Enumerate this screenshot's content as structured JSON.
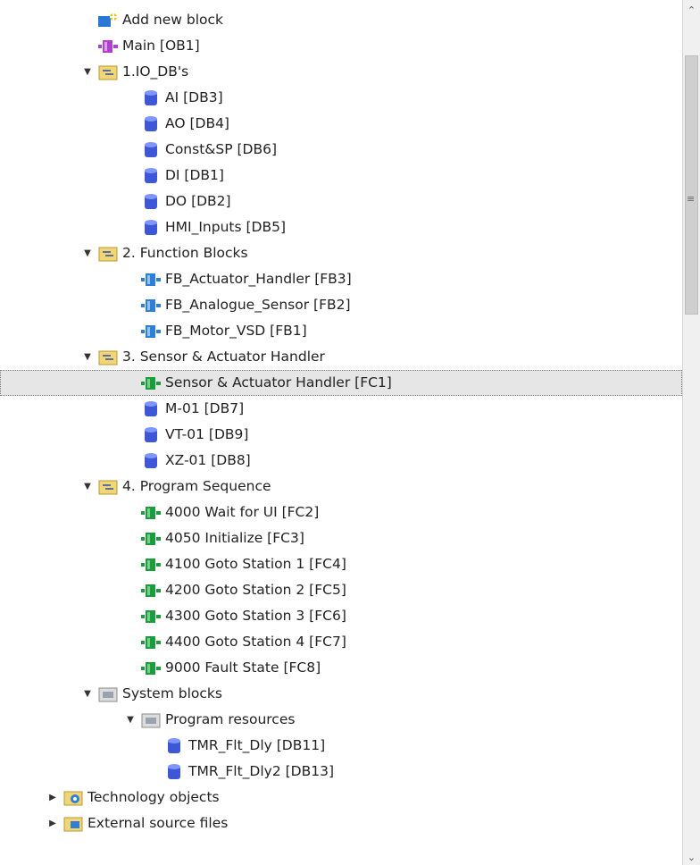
{
  "rows": [
    {
      "label": "Add new block",
      "icon": "add-block-icon",
      "level": 0,
      "toggle": "none"
    },
    {
      "label": "Main [OB1]",
      "icon": "ob-block-icon",
      "level": 0,
      "toggle": "none"
    },
    {
      "label": "1.IO_DB's",
      "icon": "folder-icon",
      "level": 0,
      "toggle": "expanded"
    },
    {
      "label": "AI [DB3]",
      "icon": "db-icon",
      "level": 1,
      "toggle": "none"
    },
    {
      "label": "AO [DB4]",
      "icon": "db-icon",
      "level": 1,
      "toggle": "none"
    },
    {
      "label": "Const&SP [DB6]",
      "icon": "db-icon",
      "level": 1,
      "toggle": "none"
    },
    {
      "label": "DI [DB1]",
      "icon": "db-icon",
      "level": 1,
      "toggle": "none"
    },
    {
      "label": "DO [DB2]",
      "icon": "db-icon",
      "level": 1,
      "toggle": "none"
    },
    {
      "label": "HMI_Inputs [DB5]",
      "icon": "db-icon",
      "level": 1,
      "toggle": "none"
    },
    {
      "label": "2. Function Blocks",
      "icon": "folder-icon",
      "level": 0,
      "toggle": "expanded"
    },
    {
      "label": "FB_Actuator_Handler [FB3]",
      "icon": "fb-block-icon",
      "level": 1,
      "toggle": "none"
    },
    {
      "label": "FB_Analogue_Sensor [FB2]",
      "icon": "fb-block-icon",
      "level": 1,
      "toggle": "none"
    },
    {
      "label": "FB_Motor_VSD [FB1]",
      "icon": "fb-block-icon",
      "level": 1,
      "toggle": "none"
    },
    {
      "label": "3. Sensor & Actuator Handler",
      "icon": "folder-icon",
      "level": 0,
      "toggle": "expanded"
    },
    {
      "label": "Sensor & Actuator Handler [FC1]",
      "icon": "fc-block-icon",
      "level": 1,
      "toggle": "none",
      "selected": true
    },
    {
      "label": "M-01 [DB7]",
      "icon": "db-icon",
      "level": 1,
      "toggle": "none"
    },
    {
      "label": "VT-01 [DB9]",
      "icon": "db-icon",
      "level": 1,
      "toggle": "none"
    },
    {
      "label": "XZ-01 [DB8]",
      "icon": "db-icon",
      "level": 1,
      "toggle": "none"
    },
    {
      "label": "4. Program Sequence",
      "icon": "folder-icon",
      "level": 0,
      "toggle": "expanded"
    },
    {
      "label": "4000 Wait for UI [FC2]",
      "icon": "fc-block-icon",
      "level": 1,
      "toggle": "none"
    },
    {
      "label": "4050 Initialize [FC3]",
      "icon": "fc-block-icon",
      "level": 1,
      "toggle": "none"
    },
    {
      "label": "4100 Goto Station 1 [FC4]",
      "icon": "fc-block-icon",
      "level": 1,
      "toggle": "none"
    },
    {
      "label": "4200 Goto Station 2 [FC5]",
      "icon": "fc-block-icon",
      "level": 1,
      "toggle": "none"
    },
    {
      "label": "4300 Goto Station 3 [FC6]",
      "icon": "fc-block-icon",
      "level": 1,
      "toggle": "none"
    },
    {
      "label": "4400 Goto Station 4 [FC7]",
      "icon": "fc-block-icon",
      "level": 1,
      "toggle": "none"
    },
    {
      "label": "9000 Fault State [FC8]",
      "icon": "fc-block-icon",
      "level": 1,
      "toggle": "none"
    },
    {
      "label": "System blocks",
      "icon": "system-folder-icon",
      "level": 0,
      "toggle": "expanded"
    },
    {
      "label": "Program resources",
      "icon": "system-folder-icon",
      "level": 1,
      "toggle": "expanded"
    },
    {
      "label": "TMR_Flt_Dly [DB11]",
      "icon": "db-icon",
      "level": 2,
      "toggle": "none"
    },
    {
      "label": "TMR_Flt_Dly2 [DB13]",
      "icon": "db-icon",
      "level": 2,
      "toggle": "none"
    },
    {
      "label": "Technology objects",
      "icon": "technology-objects-icon",
      "level": -1,
      "toggle": "collapsed"
    },
    {
      "label": "External source files",
      "icon": "external-source-icon",
      "level": -1,
      "toggle": "collapsed"
    }
  ],
  "colors": {
    "selection": "#e6e6e6",
    "db_blue": "#3d57d6",
    "fc_green": "#1e9b3c",
    "fb_blue": "#2f7fd6",
    "ob_purple": "#b040d0",
    "folder_yellow": "#f2d675"
  }
}
